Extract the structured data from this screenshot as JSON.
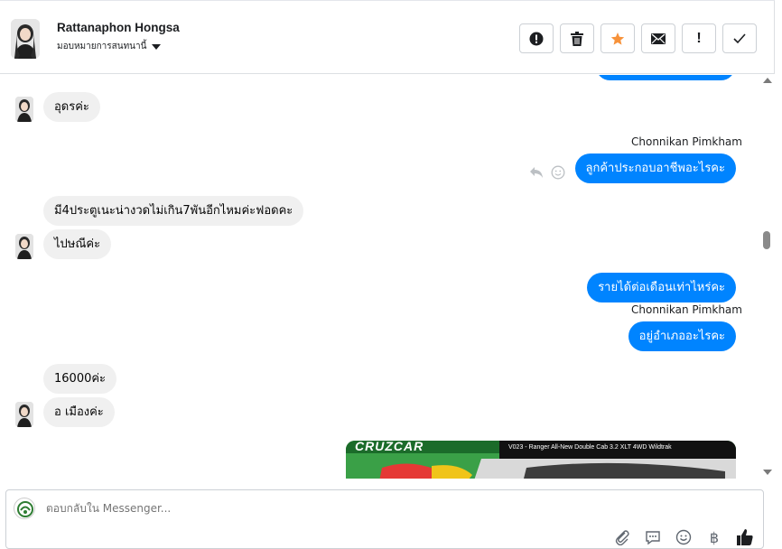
{
  "header": {
    "contact_name": "Rattanaphon Hongsa",
    "assign_label": "มอบหมายการสนทนานี้",
    "toolbar": [
      {
        "name": "alert-button",
        "icon": "exclamation-circle-icon",
        "label": "❗"
      },
      {
        "name": "delete-button",
        "icon": "trash-icon",
        "label": ""
      },
      {
        "name": "star-button",
        "icon": "star-icon",
        "label": "★"
      },
      {
        "name": "email-button",
        "icon": "envelope-icon",
        "label": "✉"
      },
      {
        "name": "mark-important-button",
        "icon": "exclamation-icon",
        "label": "!"
      },
      {
        "name": "mark-done-button",
        "icon": "check-icon",
        "label": "✓"
      }
    ]
  },
  "messages": [
    {
      "side": "in",
      "text": "อุดรค่ะ"
    },
    {
      "side": "out",
      "sender": "Chonnikan Pimkham",
      "text": "ลูกค้าประกอบอาชีพอะไรคะ"
    },
    {
      "side": "in",
      "text": "มี4ประตูเนะน่างวดไม่เกิน7พันอีกไหมค่ะฟอดคะ"
    },
    {
      "side": "in",
      "text": "ไปษณีค่ะ"
    },
    {
      "side": "out",
      "text": "รายได้ต่อเดือนเท่าไหร่คะ"
    },
    {
      "side": "out",
      "sender": "Chonnikan Pimkham",
      "text": "อยู่อำเภออะไรคะ"
    },
    {
      "side": "in",
      "text": "16000ค่ะ"
    },
    {
      "side": "in",
      "text": "อ เมืองค่ะ"
    }
  ],
  "image_attachment": {
    "banner_text": "CRUZCAR",
    "caption": "V023 - Ranger All-New Double Cab 3.2 XLT 4WD Wildtrak"
  },
  "composer": {
    "placeholder": "ตอบกลับใน Messenger...",
    "icons": [
      "paperclip-icon",
      "saved-reply-icon",
      "emoji-icon",
      "baht-icon",
      "thumbs-up-icon"
    ]
  },
  "colors": {
    "outgoing_bubble": "#0084ff",
    "incoming_bubble": "#f0f0f0",
    "star": "#f7923a"
  }
}
